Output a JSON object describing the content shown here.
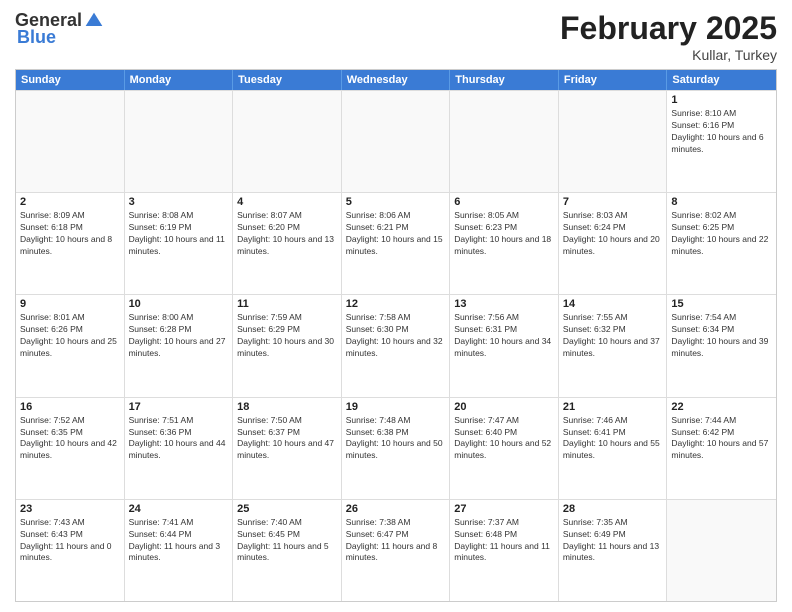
{
  "header": {
    "logo_general": "General",
    "logo_blue": "Blue",
    "month_title": "February 2025",
    "subtitle": "Kullar, Turkey"
  },
  "days_of_week": [
    "Sunday",
    "Monday",
    "Tuesday",
    "Wednesday",
    "Thursday",
    "Friday",
    "Saturday"
  ],
  "weeks": [
    [
      {
        "day": "",
        "empty": true
      },
      {
        "day": "",
        "empty": true
      },
      {
        "day": "",
        "empty": true
      },
      {
        "day": "",
        "empty": true
      },
      {
        "day": "",
        "empty": true
      },
      {
        "day": "",
        "empty": true
      },
      {
        "day": "1",
        "sunrise": "8:10 AM",
        "sunset": "6:16 PM",
        "daylight": "10 hours and 6 minutes."
      }
    ],
    [
      {
        "day": "2",
        "sunrise": "8:09 AM",
        "sunset": "6:18 PM",
        "daylight": "10 hours and 8 minutes."
      },
      {
        "day": "3",
        "sunrise": "8:08 AM",
        "sunset": "6:19 PM",
        "daylight": "10 hours and 11 minutes."
      },
      {
        "day": "4",
        "sunrise": "8:07 AM",
        "sunset": "6:20 PM",
        "daylight": "10 hours and 13 minutes."
      },
      {
        "day": "5",
        "sunrise": "8:06 AM",
        "sunset": "6:21 PM",
        "daylight": "10 hours and 15 minutes."
      },
      {
        "day": "6",
        "sunrise": "8:05 AM",
        "sunset": "6:23 PM",
        "daylight": "10 hours and 18 minutes."
      },
      {
        "day": "7",
        "sunrise": "8:03 AM",
        "sunset": "6:24 PM",
        "daylight": "10 hours and 20 minutes."
      },
      {
        "day": "8",
        "sunrise": "8:02 AM",
        "sunset": "6:25 PM",
        "daylight": "10 hours and 22 minutes."
      }
    ],
    [
      {
        "day": "9",
        "sunrise": "8:01 AM",
        "sunset": "6:26 PM",
        "daylight": "10 hours and 25 minutes."
      },
      {
        "day": "10",
        "sunrise": "8:00 AM",
        "sunset": "6:28 PM",
        "daylight": "10 hours and 27 minutes."
      },
      {
        "day": "11",
        "sunrise": "7:59 AM",
        "sunset": "6:29 PM",
        "daylight": "10 hours and 30 minutes."
      },
      {
        "day": "12",
        "sunrise": "7:58 AM",
        "sunset": "6:30 PM",
        "daylight": "10 hours and 32 minutes."
      },
      {
        "day": "13",
        "sunrise": "7:56 AM",
        "sunset": "6:31 PM",
        "daylight": "10 hours and 34 minutes."
      },
      {
        "day": "14",
        "sunrise": "7:55 AM",
        "sunset": "6:32 PM",
        "daylight": "10 hours and 37 minutes."
      },
      {
        "day": "15",
        "sunrise": "7:54 AM",
        "sunset": "6:34 PM",
        "daylight": "10 hours and 39 minutes."
      }
    ],
    [
      {
        "day": "16",
        "sunrise": "7:52 AM",
        "sunset": "6:35 PM",
        "daylight": "10 hours and 42 minutes."
      },
      {
        "day": "17",
        "sunrise": "7:51 AM",
        "sunset": "6:36 PM",
        "daylight": "10 hours and 44 minutes."
      },
      {
        "day": "18",
        "sunrise": "7:50 AM",
        "sunset": "6:37 PM",
        "daylight": "10 hours and 47 minutes."
      },
      {
        "day": "19",
        "sunrise": "7:48 AM",
        "sunset": "6:38 PM",
        "daylight": "10 hours and 50 minutes."
      },
      {
        "day": "20",
        "sunrise": "7:47 AM",
        "sunset": "6:40 PM",
        "daylight": "10 hours and 52 minutes."
      },
      {
        "day": "21",
        "sunrise": "7:46 AM",
        "sunset": "6:41 PM",
        "daylight": "10 hours and 55 minutes."
      },
      {
        "day": "22",
        "sunrise": "7:44 AM",
        "sunset": "6:42 PM",
        "daylight": "10 hours and 57 minutes."
      }
    ],
    [
      {
        "day": "23",
        "sunrise": "7:43 AM",
        "sunset": "6:43 PM",
        "daylight": "11 hours and 0 minutes."
      },
      {
        "day": "24",
        "sunrise": "7:41 AM",
        "sunset": "6:44 PM",
        "daylight": "11 hours and 3 minutes."
      },
      {
        "day": "25",
        "sunrise": "7:40 AM",
        "sunset": "6:45 PM",
        "daylight": "11 hours and 5 minutes."
      },
      {
        "day": "26",
        "sunrise": "7:38 AM",
        "sunset": "6:47 PM",
        "daylight": "11 hours and 8 minutes."
      },
      {
        "day": "27",
        "sunrise": "7:37 AM",
        "sunset": "6:48 PM",
        "daylight": "11 hours and 11 minutes."
      },
      {
        "day": "28",
        "sunrise": "7:35 AM",
        "sunset": "6:49 PM",
        "daylight": "11 hours and 13 minutes."
      },
      {
        "day": "",
        "empty": true
      }
    ]
  ],
  "labels": {
    "sunrise": "Sunrise:",
    "sunset": "Sunset:",
    "daylight": "Daylight:"
  }
}
